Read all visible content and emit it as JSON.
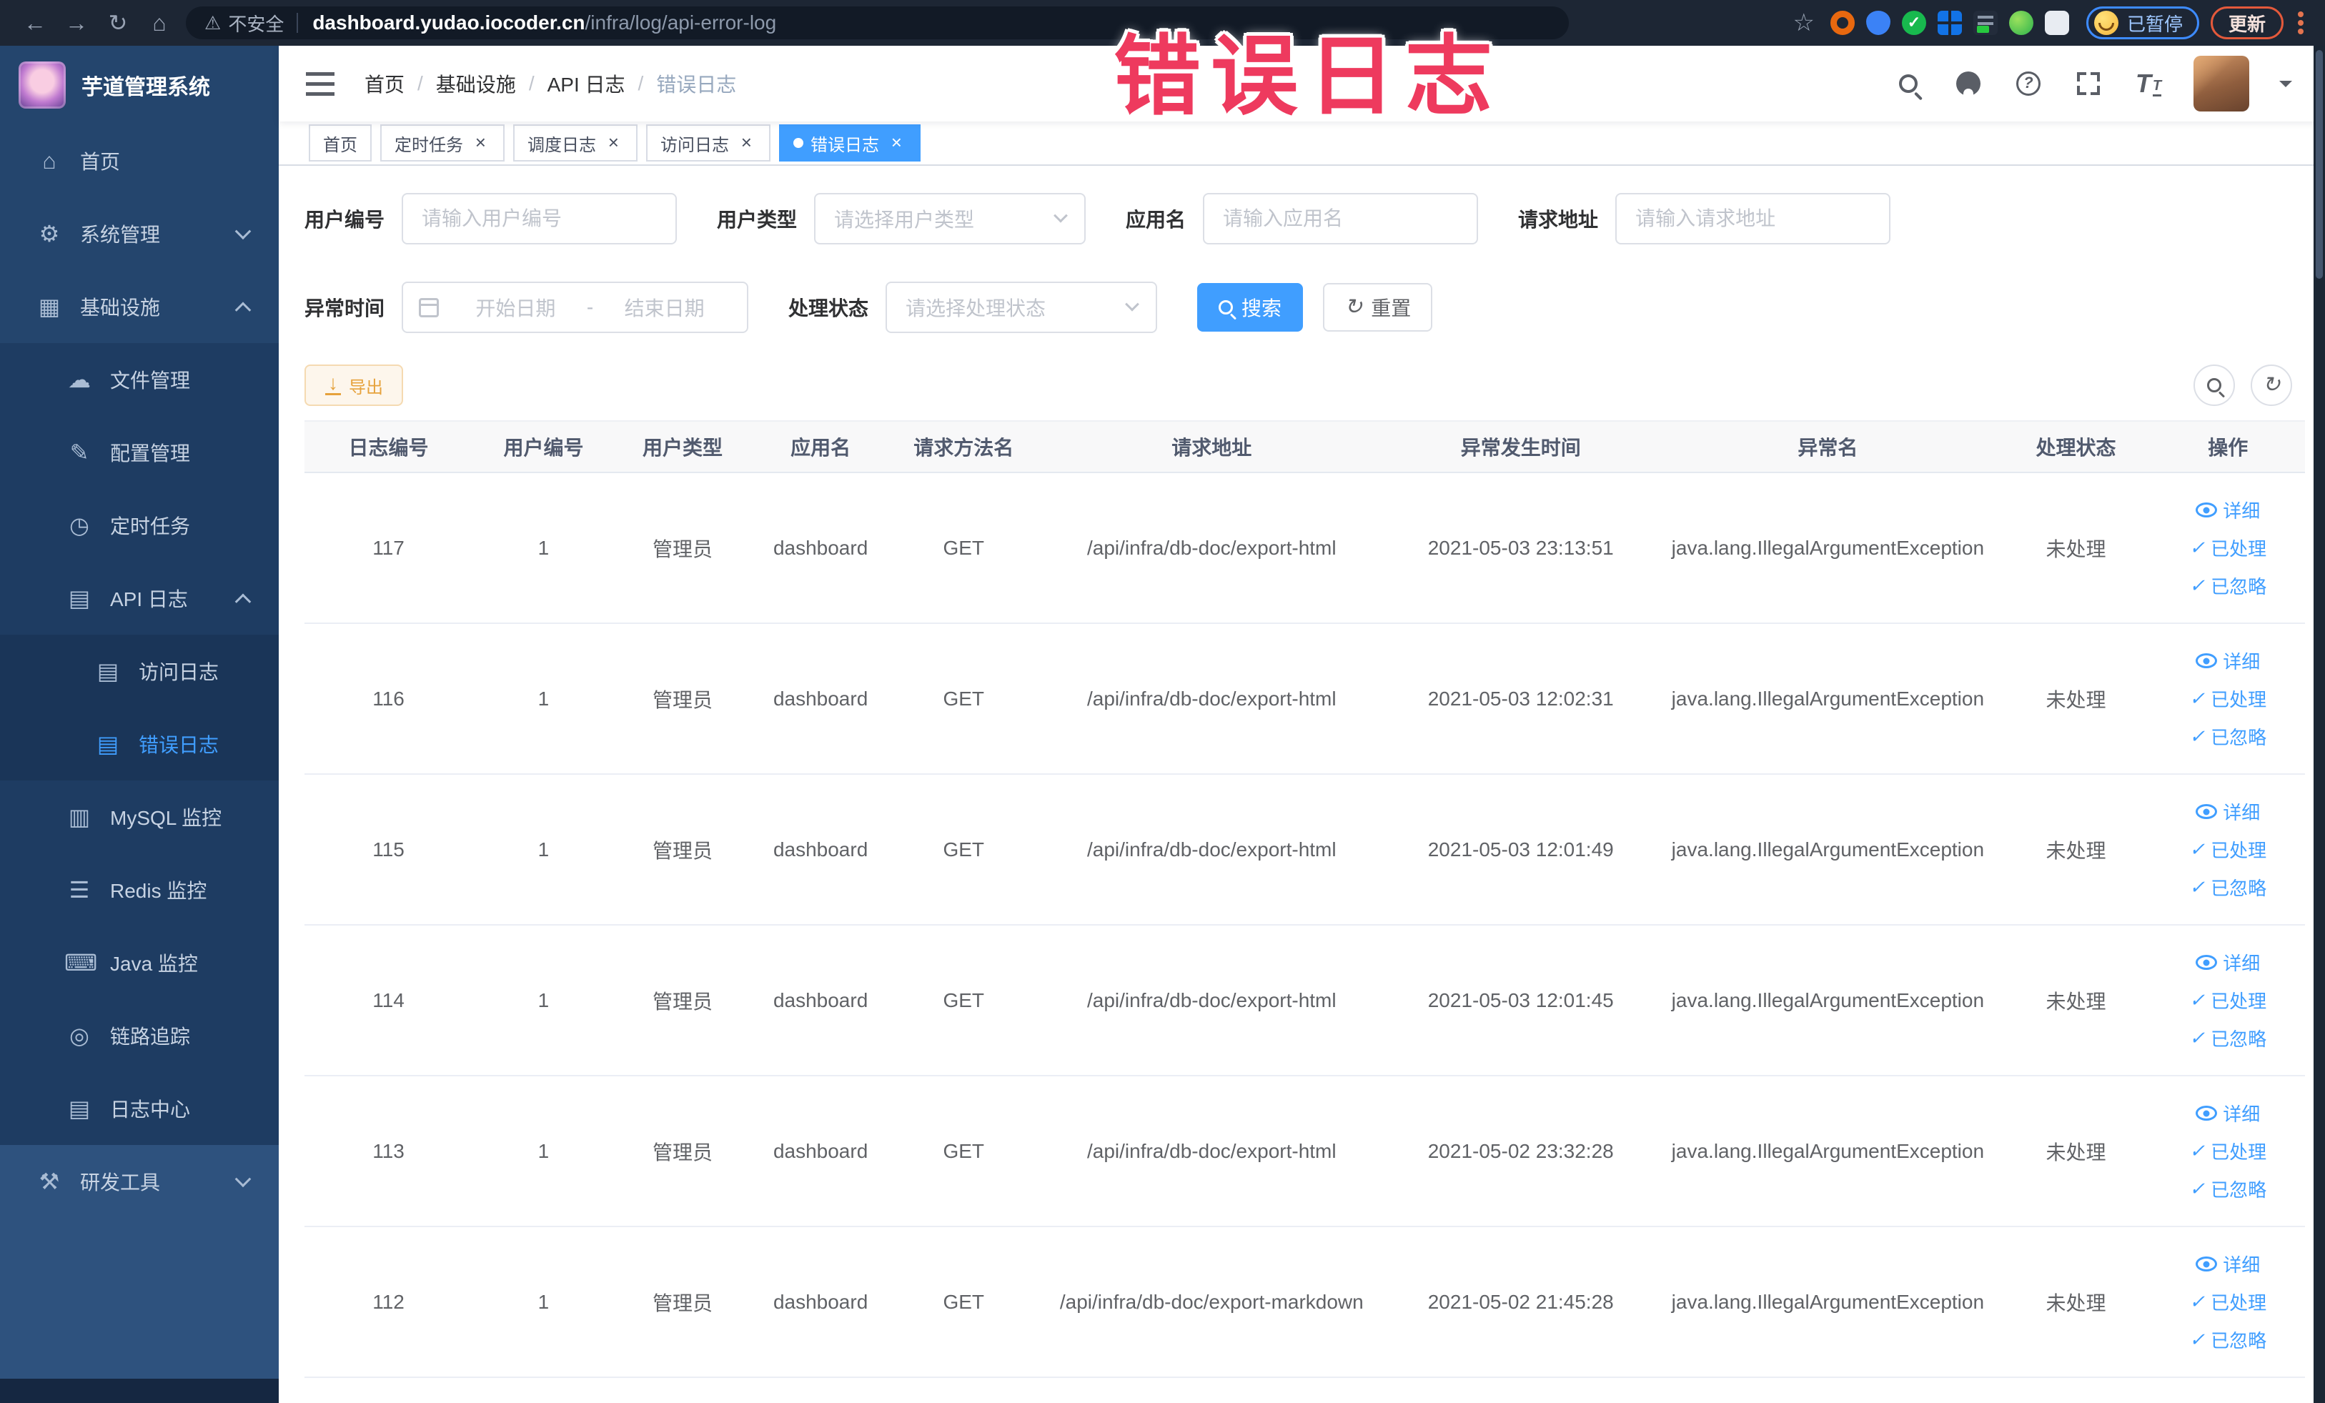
{
  "annotation": {
    "text": "错误日志"
  },
  "theme": {
    "primary": "#409eff",
    "warning": "#e6a23c",
    "annotation_color": "#ee3a5e",
    "sidebar_bg": "#24456d",
    "chrome_bg": "#1d2634"
  },
  "browser": {
    "security_label": "不安全",
    "url_host": "dashboard.yudao.iocoder.cn",
    "url_path": "/infra/log/api-error-log",
    "paused_badge": "已暂停",
    "update_label": "更新"
  },
  "sidebar": {
    "title": "芋道管理系统",
    "menu": [
      {
        "label": "首页",
        "level": 1,
        "icon": "home-icon"
      },
      {
        "label": "系统管理",
        "level": 1,
        "icon": "gear-icon",
        "chevron": "down"
      },
      {
        "label": "基础设施",
        "level": 1,
        "icon": "infra-icon",
        "chevron": "up"
      },
      {
        "label": "文件管理",
        "level": 2,
        "icon": "file-manage-icon"
      },
      {
        "label": "配置管理",
        "level": 2,
        "icon": "config-icon"
      },
      {
        "label": "定时任务",
        "level": 2,
        "icon": "cron-icon"
      },
      {
        "label": "API 日志",
        "level": 2,
        "icon": "api-log-icon",
        "chevron": "up"
      },
      {
        "label": "访问日志",
        "level": 3,
        "icon": "access-log-icon"
      },
      {
        "label": "错误日志",
        "level": 3,
        "icon": "error-log-icon",
        "active": true
      },
      {
        "label": "MySQL 监控",
        "level": 2,
        "icon": "mysql-icon"
      },
      {
        "label": "Redis 监控",
        "level": 2,
        "icon": "redis-icon"
      },
      {
        "label": "Java 监控",
        "level": 2,
        "icon": "java-icon"
      },
      {
        "label": "链路追踪",
        "level": 2,
        "icon": "trace-icon"
      },
      {
        "label": "日志中心",
        "level": 2,
        "icon": "log-center-icon"
      },
      {
        "label": "研发工具",
        "level": 1,
        "icon": "devtools-icon",
        "chevron": "down",
        "bottom": true
      }
    ]
  },
  "breadcrumb": [
    {
      "label": "首页"
    },
    {
      "label": "基础设施"
    },
    {
      "label": "API 日志"
    },
    {
      "label": "错误日志",
      "last": true
    }
  ],
  "breadcrumb_separator": "/",
  "tags": [
    {
      "label": "首页",
      "closable": false
    },
    {
      "label": "定时任务"
    },
    {
      "label": "调度日志"
    },
    {
      "label": "访问日志"
    },
    {
      "label": "错误日志",
      "active": true
    }
  ],
  "filters": {
    "user_id": {
      "label": "用户编号",
      "placeholder": "请输入用户编号"
    },
    "user_type": {
      "label": "用户类型",
      "placeholder": "请选择用户类型"
    },
    "app_name": {
      "label": "应用名",
      "placeholder": "请输入应用名"
    },
    "request_url": {
      "label": "请求地址",
      "placeholder": "请输入请求地址"
    },
    "exception_time": {
      "label": "异常时间",
      "start_placeholder": "开始日期",
      "separator": "-",
      "end_placeholder": "结束日期"
    },
    "process_status": {
      "label": "处理状态",
      "placeholder": "请选择处理状态"
    },
    "search_label": "搜索",
    "reset_label": "重置"
  },
  "toolbar": {
    "export_label": "导出"
  },
  "table": {
    "headers": [
      "日志编号",
      "用户编号",
      "用户类型",
      "应用名",
      "请求方法名",
      "请求地址",
      "异常发生时间",
      "异常名",
      "处理状态",
      "操作"
    ],
    "ops": {
      "detail": "详细",
      "processed": "已处理",
      "ignored": "已忽略"
    },
    "rows": [
      {
        "log_id": "117",
        "user_id": "1",
        "user_type": "管理员",
        "app_name": "dashboard",
        "method": "GET",
        "url": "/api/infra/db-doc/export-html",
        "time": "2021-05-03 23:13:51",
        "exception": "java.lang.IllegalArgumentException",
        "status": "未处理"
      },
      {
        "log_id": "116",
        "user_id": "1",
        "user_type": "管理员",
        "app_name": "dashboard",
        "method": "GET",
        "url": "/api/infra/db-doc/export-html",
        "time": "2021-05-03 12:02:31",
        "exception": "java.lang.IllegalArgumentException",
        "status": "未处理"
      },
      {
        "log_id": "115",
        "user_id": "1",
        "user_type": "管理员",
        "app_name": "dashboard",
        "method": "GET",
        "url": "/api/infra/db-doc/export-html",
        "time": "2021-05-03 12:01:49",
        "exception": "java.lang.IllegalArgumentException",
        "status": "未处理"
      },
      {
        "log_id": "114",
        "user_id": "1",
        "user_type": "管理员",
        "app_name": "dashboard",
        "method": "GET",
        "url": "/api/infra/db-doc/export-html",
        "time": "2021-05-03 12:01:45",
        "exception": "java.lang.IllegalArgumentException",
        "status": "未处理"
      },
      {
        "log_id": "113",
        "user_id": "1",
        "user_type": "管理员",
        "app_name": "dashboard",
        "method": "GET",
        "url": "/api/infra/db-doc/export-html",
        "time": "2021-05-02 23:32:28",
        "exception": "java.lang.IllegalArgumentException",
        "status": "未处理"
      },
      {
        "log_id": "112",
        "user_id": "1",
        "user_type": "管理员",
        "app_name": "dashboard",
        "method": "GET",
        "url": "/api/infra/db-doc/export-markdown",
        "time": "2021-05-02 21:45:28",
        "exception": "java.lang.IllegalArgumentException",
        "status": "未处理"
      }
    ]
  }
}
